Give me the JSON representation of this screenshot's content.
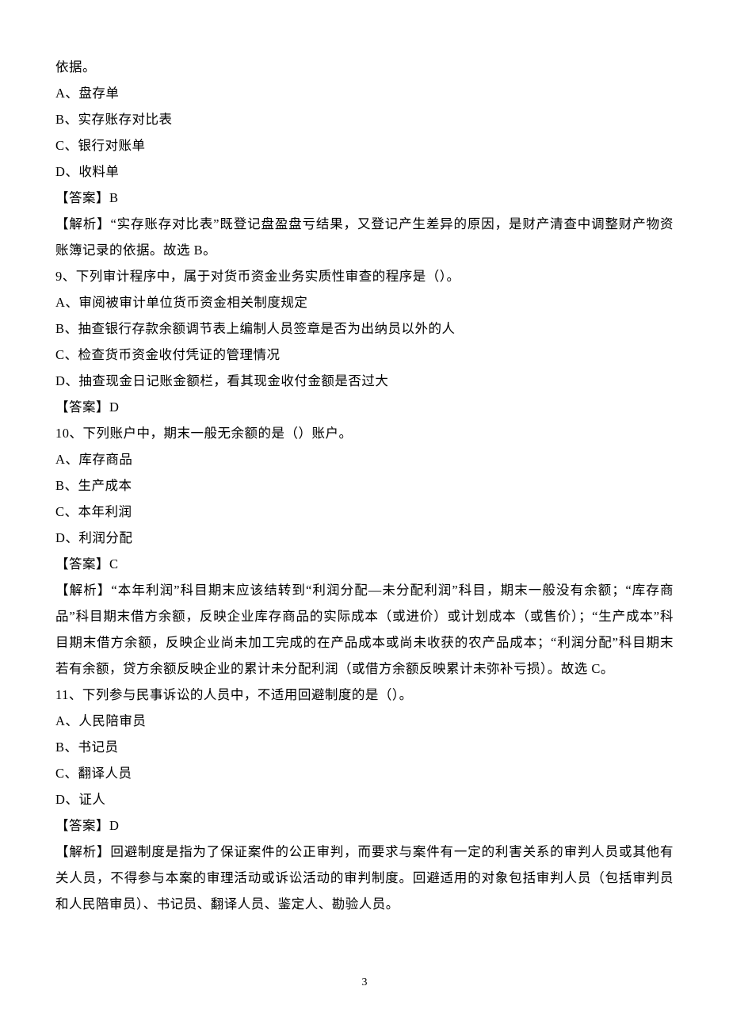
{
  "lines": {
    "l0": "依据。",
    "l1": "A、盘存单",
    "l2": "B、实存账存对比表",
    "l3": "C、银行对账单",
    "l4": "D、收料单",
    "l5": "【答案】B",
    "l6": "【解析】“实存账存对比表”既登记盘盈盘亏结果，又登记产生差异的原因，是财产清查中调整财产物资账簿记录的依据。故选 B。",
    "l7": "9、下列审计程序中，属于对货币资金业务实质性审查的程序是（）。",
    "l8": "A、审阅被审计单位货币资金相关制度规定",
    "l9": "B、抽查银行存款余额调节表上编制人员签章是否为出纳员以外的人",
    "l10": "C、检查货币资金收付凭证的管理情况",
    "l11": "D、抽查现金日记账金额栏，看其现金收付金额是否过大",
    "l12": "【答案】D",
    "l13": "10、下列账户中，期末一般无余额的是（）账户。",
    "l14": "A、库存商品",
    "l15": "B、生产成本",
    "l16": "C、本年利润",
    "l17": "D、利润分配",
    "l18": "【答案】C",
    "l19": "【解析】“本年利润”科目期末应该结转到“利润分配—未分配利润”科目，期末一般没有余额；“库存商品”科目期末借方余额，反映企业库存商品的实际成本（或进价）或计划成本（或售价）；“生产成本”科目期末借方余额，反映企业尚未加工完成的在产品成本或尚未收获的农产品成本；“利润分配”科目期末若有余额，贷方余额反映企业的累计未分配利润（或借方余额反映累计未弥补亏损）。故选 C。",
    "l20": "11、下列参与民事诉讼的人员中，不适用回避制度的是（）。",
    "l21": "A、人民陪审员",
    "l22": "B、书记员",
    "l23": "C、翻译人员",
    "l24": "D、证人",
    "l25": "【答案】D",
    "l26": "【解析】回避制度是指为了保证案件的公正审判，而要求与案件有一定的利害关系的审判人员或其他有关人员，不得参与本案的审理活动或诉讼活动的审判制度。回避适用的对象包括审判人员（包括审判员和人民陪审员）、书记员、翻译人员、鉴定人、勘验人员。"
  },
  "page_number": "3"
}
